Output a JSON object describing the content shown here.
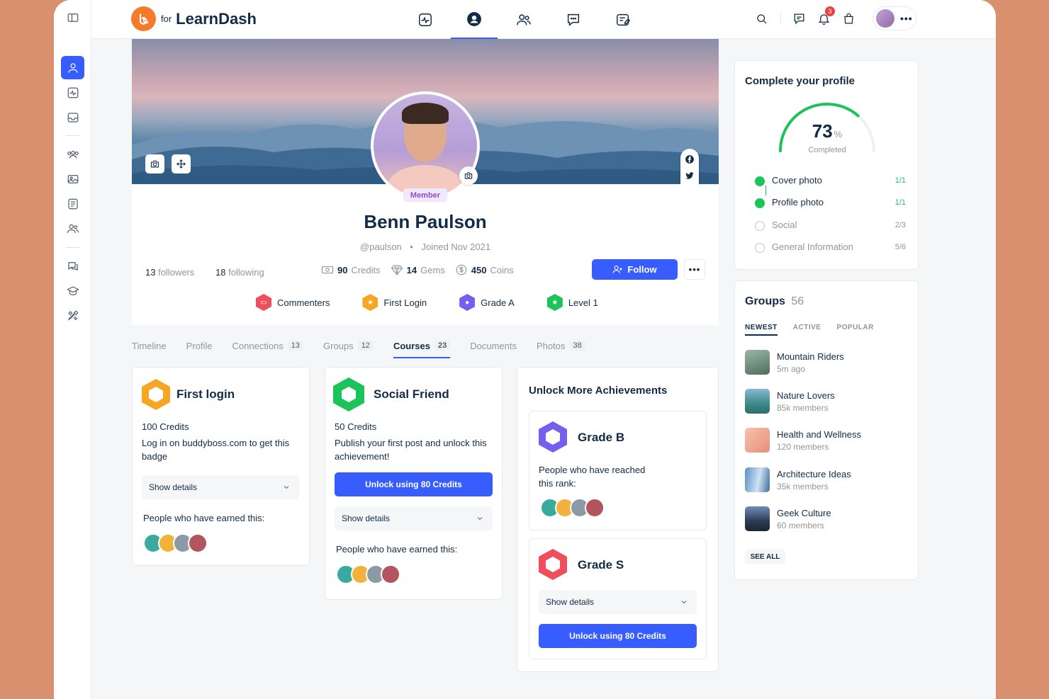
{
  "brand": {
    "logo_letter": "bb",
    "for": "for",
    "name": "LearnDash"
  },
  "colors": {
    "accent": "#385dff",
    "orange": "#f47b2a",
    "green": "#1cc35b"
  },
  "topbar": {
    "nav_icons": [
      "activity-icon",
      "profile-icon",
      "members-icon",
      "messages-icon",
      "courses-icon"
    ],
    "notification_count": "3"
  },
  "profile": {
    "member_tag": "Member",
    "name": "Benn Paulson",
    "handle": "@paulson",
    "joined": "Joined Nov 2021",
    "followers_count": "13",
    "followers_label": "followers",
    "following_count": "18",
    "following_label": "following",
    "credits_value": "90",
    "credits_label": "Credits",
    "gems_value": "14",
    "gems_label": "Gems",
    "coins_value": "450",
    "coins_label": "Coins",
    "follow_label": "Follow",
    "badges": [
      {
        "label": "Commenters",
        "color": "#ef4e5c"
      },
      {
        "label": "First Login",
        "color": "#f5a623"
      },
      {
        "label": "Grade A",
        "color": "#7460ee"
      },
      {
        "label": "Level 1",
        "color": "#1cc35b"
      }
    ]
  },
  "tabs": [
    {
      "label": "Timeline",
      "count": ""
    },
    {
      "label": "Profile",
      "count": ""
    },
    {
      "label": "Connections",
      "count": "13"
    },
    {
      "label": "Groups",
      "count": "12"
    },
    {
      "label": "Courses",
      "count": "23"
    },
    {
      "label": "Documents",
      "count": ""
    },
    {
      "label": "Photos",
      "count": "38"
    }
  ],
  "achievements": {
    "first_login": {
      "title": "First login",
      "credits": "100 Credits",
      "description": "Log in on buddyboss.com to get this badge",
      "details_label": "Show details",
      "earned_label": "People who have earned this:"
    },
    "social_friend": {
      "title": "Social Friend",
      "credits": "50 Credits",
      "description": "Publish your first post and unlock this achievement!",
      "unlock_label": "Unlock using 80 Credits",
      "details_label": "Show details",
      "earned_label": "People who have earned this:"
    },
    "unlock_more": {
      "title": "Unlock More Achievements",
      "grade_b": {
        "title": "Grade B",
        "description": "People who have reached this rank:"
      },
      "grade_s": {
        "title": "Grade S",
        "details_label": "Show details",
        "unlock_label": "Unlock using 80 Credits"
      }
    }
  },
  "complete_profile": {
    "title": "Complete your profile",
    "percent": "73",
    "percent_sign": "%",
    "completed_label": "Completed",
    "progress_fraction": 0.73,
    "items": [
      {
        "label": "Cover photo",
        "value": "1/1",
        "done": true
      },
      {
        "label": "Profile photo",
        "value": "1/1",
        "done": true
      },
      {
        "label": "Social",
        "value": "2/3",
        "done": false
      },
      {
        "label": "General Information",
        "value": "5/6",
        "done": false
      }
    ]
  },
  "groups": {
    "title": "Groups",
    "count": "56",
    "tabs": [
      "NEWEST",
      "ACTIVE",
      "POPULAR"
    ],
    "items": [
      {
        "name": "Mountain Riders",
        "sub": "5m ago"
      },
      {
        "name": "Nature Lovers",
        "sub": "85k members"
      },
      {
        "name": "Health and Wellness",
        "sub": "120 members"
      },
      {
        "name": "Architecture Ideas",
        "sub": "35k members"
      },
      {
        "name": "Geek Culture",
        "sub": "60 members"
      }
    ],
    "see_all": "SEE ALL"
  }
}
